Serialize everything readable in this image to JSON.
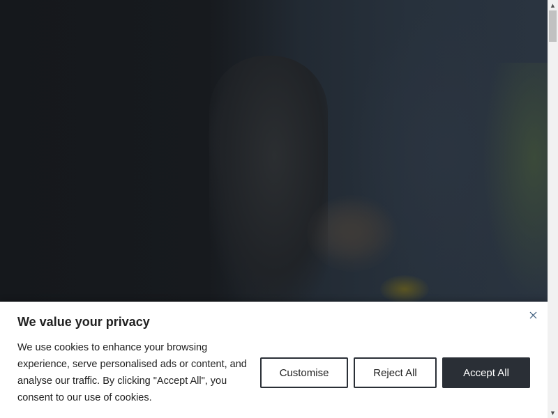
{
  "colors": {
    "banner_bg": "#ffffff",
    "text": "#212121",
    "button_border": "#2a2f36",
    "accept_bg": "#2a2f36",
    "accept_text": "#ffffff"
  },
  "cookie_banner": {
    "title": "We value your privacy",
    "body": "We use cookies to enhance your browsing experience, serve personalised ads or content, and analyse our traffic. By clicking \"Accept All\", you consent to our use of cookies.",
    "close_icon": "close-icon",
    "buttons": {
      "customise": "Customise",
      "reject": "Reject All",
      "accept": "Accept All"
    }
  },
  "scrollbar": {
    "up_icon": "▲",
    "down_icon": "▼"
  }
}
